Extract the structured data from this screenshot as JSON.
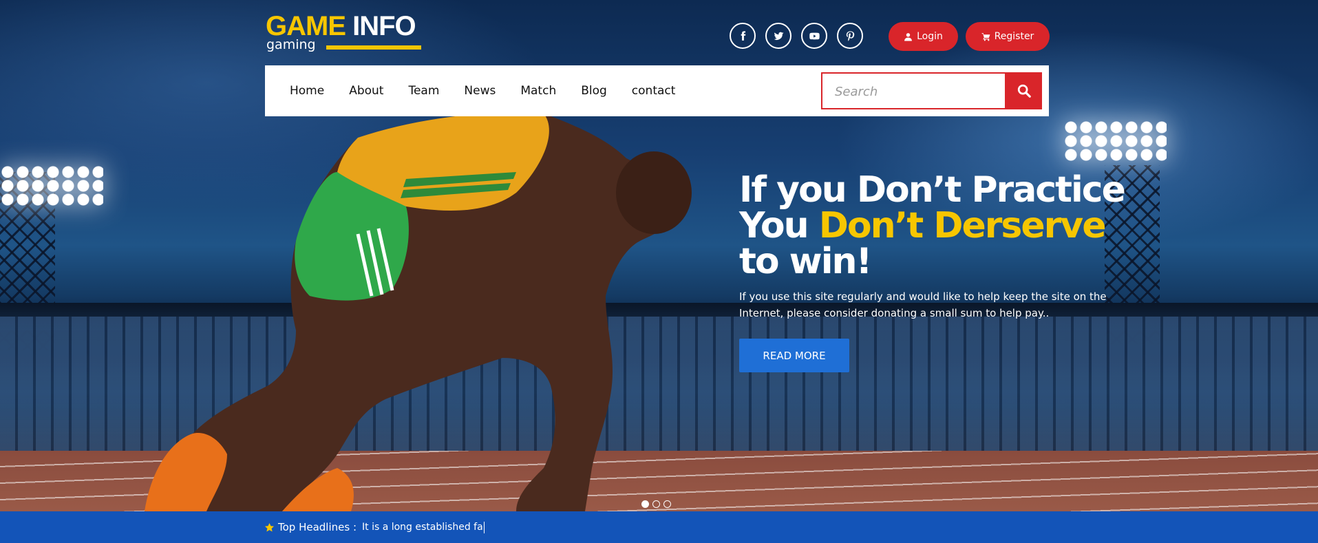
{
  "brand": {
    "name_part1": "GAME",
    "name_part2": "INFO",
    "tagline": "gaming",
    "accent_color": "#f7c600"
  },
  "header": {
    "social_links": [
      {
        "icon": "facebook-icon",
        "label": "Facebook"
      },
      {
        "icon": "twitter-icon",
        "label": "Twitter"
      },
      {
        "icon": "youtube-icon",
        "label": "YouTube"
      },
      {
        "icon": "pinterest-icon",
        "label": "Pinterest"
      }
    ],
    "login_label": "Login",
    "register_label": "Register",
    "button_color": "#d9252a"
  },
  "nav": {
    "items": [
      "Home",
      "About",
      "Team",
      "News",
      "Match",
      "Blog",
      "contact"
    ],
    "search_placeholder": "Search"
  },
  "hero": {
    "headline_line1": "If you Don’t Practice",
    "headline_line2_prefix": "You",
    "headline_line2_highlight": "Don’t Derserve",
    "headline_line3": "to win!",
    "subtext": "If you use this site regularly and would like to help keep the site on the Internet, please consider donating a small sum to help pay..",
    "cta_label": "READ MORE",
    "cta_color": "#1f6fd6",
    "slides_total": 3,
    "slide_active": 1
  },
  "ticker": {
    "label": "Top Headlines :",
    "text": "It is a long established fa",
    "background": "#1354b8"
  }
}
